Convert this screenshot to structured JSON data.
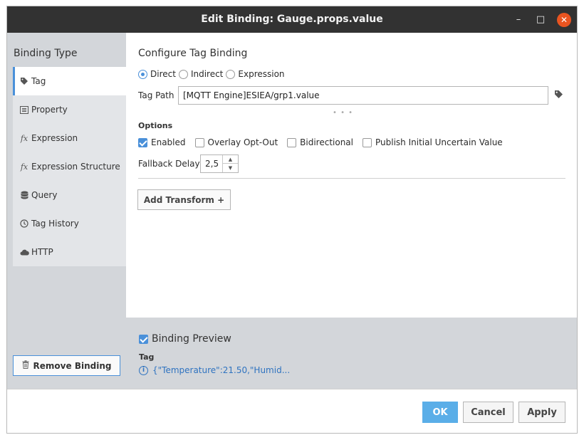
{
  "window": {
    "title": "Edit Binding: Gauge.props.value",
    "controls": {
      "minimize": "–",
      "maximize": "□",
      "close": "✕"
    }
  },
  "sidebar": {
    "title": "Binding Type",
    "items": [
      {
        "label": "Tag",
        "icon": "tag-icon",
        "glyph": "🏷"
      },
      {
        "label": "Property",
        "icon": "property-icon",
        "glyph": "▤"
      },
      {
        "label": "Expression",
        "icon": "fx-icon",
        "glyph": "fx"
      },
      {
        "label": "Expression Structure",
        "icon": "fx-icon",
        "glyph": "fx"
      },
      {
        "label": "Query",
        "icon": "database-icon",
        "glyph": "⛁"
      },
      {
        "label": "Tag History",
        "icon": "clock-icon",
        "glyph": "◷"
      },
      {
        "label": "HTTP",
        "icon": "cloud-icon",
        "glyph": "☁"
      }
    ],
    "active_index": 0,
    "remove_button": "Remove Binding"
  },
  "main": {
    "title": "Configure Tag Binding",
    "mode_options": [
      "Direct",
      "Indirect",
      "Expression"
    ],
    "selected_mode": "Direct",
    "tag_path_label": "Tag Path",
    "tag_path_value": "[MQTT Engine]ESIEA/grp1.value",
    "options_label": "Options",
    "checkboxes": [
      {
        "label": "Enabled",
        "checked": true
      },
      {
        "label": "Overlay Opt-Out",
        "checked": false
      },
      {
        "label": "Bidirectional",
        "checked": false
      },
      {
        "label": "Publish Initial Uncertain Value",
        "checked": false
      }
    ],
    "fallback_delay_label": "Fallback Delay",
    "fallback_delay_value": "2,5",
    "add_transform": "Add Transform +"
  },
  "preview": {
    "title": "Binding Preview",
    "checked": true,
    "subtitle": "Tag",
    "value": "{\"Temperature\":21.50,\"Humid..."
  },
  "footer": {
    "ok": "OK",
    "cancel": "Cancel",
    "apply": "Apply"
  },
  "colors": {
    "accent": "#4a90d9",
    "titlebar": "#323232",
    "close_button": "#e95420",
    "ok_button": "#5aaee8",
    "sidebar_bg": "#d3d6da"
  }
}
